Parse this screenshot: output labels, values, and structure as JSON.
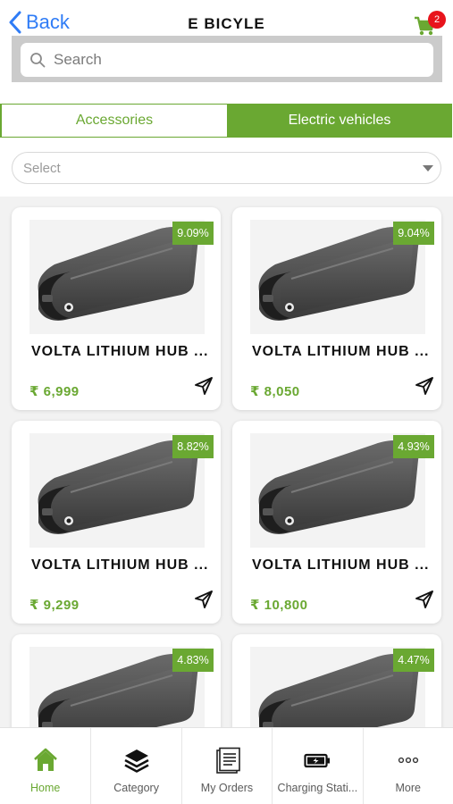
{
  "header": {
    "back_label": "Back",
    "title": "E BICYLE",
    "cart_count": "2"
  },
  "search": {
    "placeholder": "Search"
  },
  "tabs": [
    {
      "label": "Accessories",
      "active": false
    },
    {
      "label": "Electric vehicles",
      "active": true
    }
  ],
  "filter": {
    "selected": "Select"
  },
  "products": [
    {
      "name": "VOLTA LITHIUM HUB ...",
      "price": "₹ 6,999",
      "discount": "9.09%"
    },
    {
      "name": "VOLTA LITHIUM HUB ...",
      "price": "₹ 8,050",
      "discount": "9.04%"
    },
    {
      "name": "VOLTA LITHIUM HUB ...",
      "price": "₹ 9,299",
      "discount": "8.82%"
    },
    {
      "name": "VOLTA LITHIUM HUB ...",
      "price": "₹ 10,800",
      "discount": "4.93%"
    },
    {
      "name": "",
      "price": "",
      "discount": "4.83%"
    },
    {
      "name": "",
      "price": "",
      "discount": "4.47%"
    }
  ],
  "bottom_nav": [
    {
      "label": "Home",
      "icon": "home-icon",
      "active": true
    },
    {
      "label": "Category",
      "icon": "layers-icon",
      "active": false
    },
    {
      "label": "My Orders",
      "icon": "orders-icon",
      "active": false
    },
    {
      "label": "Charging Stati...",
      "icon": "battery-icon",
      "active": false
    },
    {
      "label": "More",
      "icon": "more-icon",
      "active": false
    }
  ],
  "colors": {
    "accent": "#6aa832",
    "link": "#2f7cf6",
    "badge_red": "#e8141c"
  }
}
